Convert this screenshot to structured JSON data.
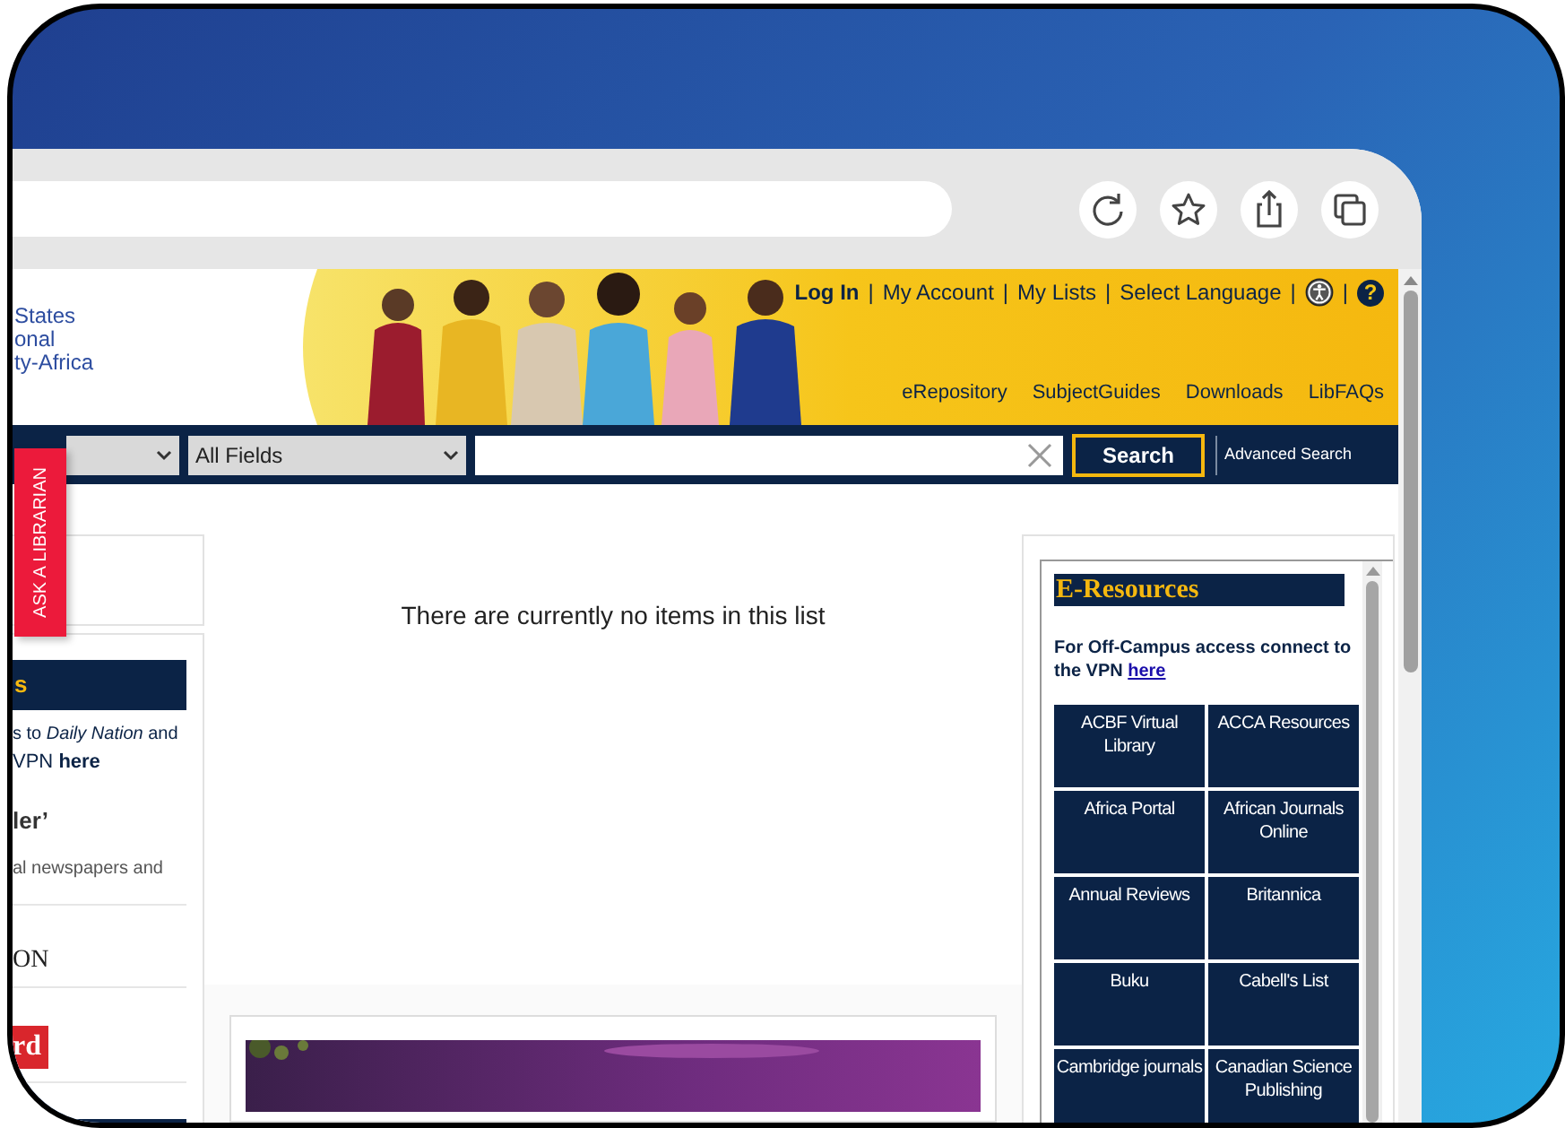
{
  "header": {
    "logo_lines": [
      "States",
      "onal",
      "ty-Africa"
    ],
    "top_links": [
      {
        "kind": "link",
        "label": "Log In",
        "bold": true
      },
      {
        "kind": "separator",
        "label": "|"
      },
      {
        "kind": "link",
        "label": "My Account",
        "bold": false
      },
      {
        "kind": "separator",
        "label": "|"
      },
      {
        "kind": "link",
        "label": "My Lists",
        "bold": false
      },
      {
        "kind": "separator",
        "label": "|"
      },
      {
        "kind": "link",
        "label": "Select Language",
        "bold": false
      },
      {
        "kind": "separator",
        "label": "|"
      },
      {
        "kind": "accessibility"
      },
      {
        "kind": "separator",
        "label": "|"
      },
      {
        "kind": "help",
        "label": "?"
      }
    ],
    "nav_links": [
      "eRepository",
      "SubjectGuides",
      "Downloads",
      "LibFAQs"
    ]
  },
  "search": {
    "field_select": "All Fields",
    "button": "Search",
    "advanced_link": "Advanced Search"
  },
  "ask_tab": "ASK A LIBRARIAN",
  "left_panel": {
    "heading": "s",
    "lines": [
      "s to *Daily Nation* and",
      "VPN **here**"
    ],
    "logo_1": "ler’",
    "caption": "al newspapers and",
    "logo_2": "ON",
    "logo_3": "rd"
  },
  "main": {
    "empty_message": "There are currently no items in this list"
  },
  "eresources": {
    "title": "E-Resources",
    "note": "For Off-Campus access connect to the VPN",
    "note_link": "here",
    "tiles": [
      "ACBF Virtual Library",
      "ACCA Resources",
      "Africa Portal",
      "African Journals Online",
      "Annual Reviews",
      "Britannica",
      "Buku",
      "Cabell's List",
      "Cambridge journals",
      "Canadian Science Publishing"
    ]
  }
}
